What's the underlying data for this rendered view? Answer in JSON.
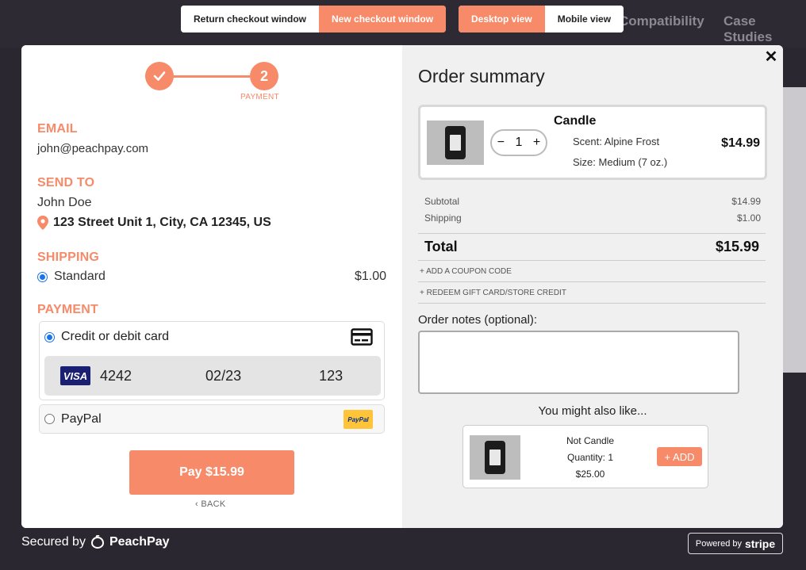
{
  "toggles": {
    "window": [
      "Return checkout window",
      "New checkout window"
    ],
    "view": [
      "Desktop view",
      "Mobile view"
    ]
  },
  "background": {
    "nav": [
      "Compatibility",
      "Case Studies"
    ]
  },
  "stepper": {
    "step2_number": "2",
    "step2_label": "PAYMENT"
  },
  "left": {
    "email_title": "EMAIL",
    "email": "john@peachpay.com",
    "send_to_title": "SEND TO",
    "name": "John Doe",
    "address": "123 Street Unit 1, City, CA 12345, US",
    "shipping_title": "SHIPPING",
    "shipping_option": "Standard",
    "shipping_price": "$1.00",
    "payment_title": "PAYMENT",
    "card_label": "Credit or debit card",
    "card_brand": "VISA",
    "card_number": "4242",
    "card_expiry": "02/23",
    "card_cvc": "123",
    "paypal_label": "PayPal",
    "paypal_badge": "PayPal",
    "pay_button": "Pay $15.99",
    "back": "BACK"
  },
  "right": {
    "title": "Order summary",
    "item": {
      "name": "Candle",
      "quantity": "1",
      "scent": "Scent: Alpine Frost",
      "size": "Size: Medium (7 oz.)",
      "price": "$14.99"
    },
    "subtotal_label": "Subtotal",
    "subtotal": "$14.99",
    "shipping_label": "Shipping",
    "shipping": "$1.00",
    "total_label": "Total",
    "total": "$15.99",
    "coupon_link": "+ ADD A COUPON CODE",
    "gift_link": "+ REDEEM GIFT CARD/STORE CREDIT",
    "notes_label": "Order notes (optional):",
    "also_title": "You might also like...",
    "also": {
      "name": "Not Candle",
      "quantity": "Quantity: 1",
      "price": "$25.00",
      "add": "+ ADD"
    }
  },
  "footer": {
    "secured_prefix": "Secured by",
    "brand": "PeachPay",
    "stripe_prefix": "Powered by",
    "stripe": "stripe"
  },
  "colors": {
    "accent": "#f68a69",
    "visa": "#1a1f71",
    "paypal": "#ffc439"
  }
}
